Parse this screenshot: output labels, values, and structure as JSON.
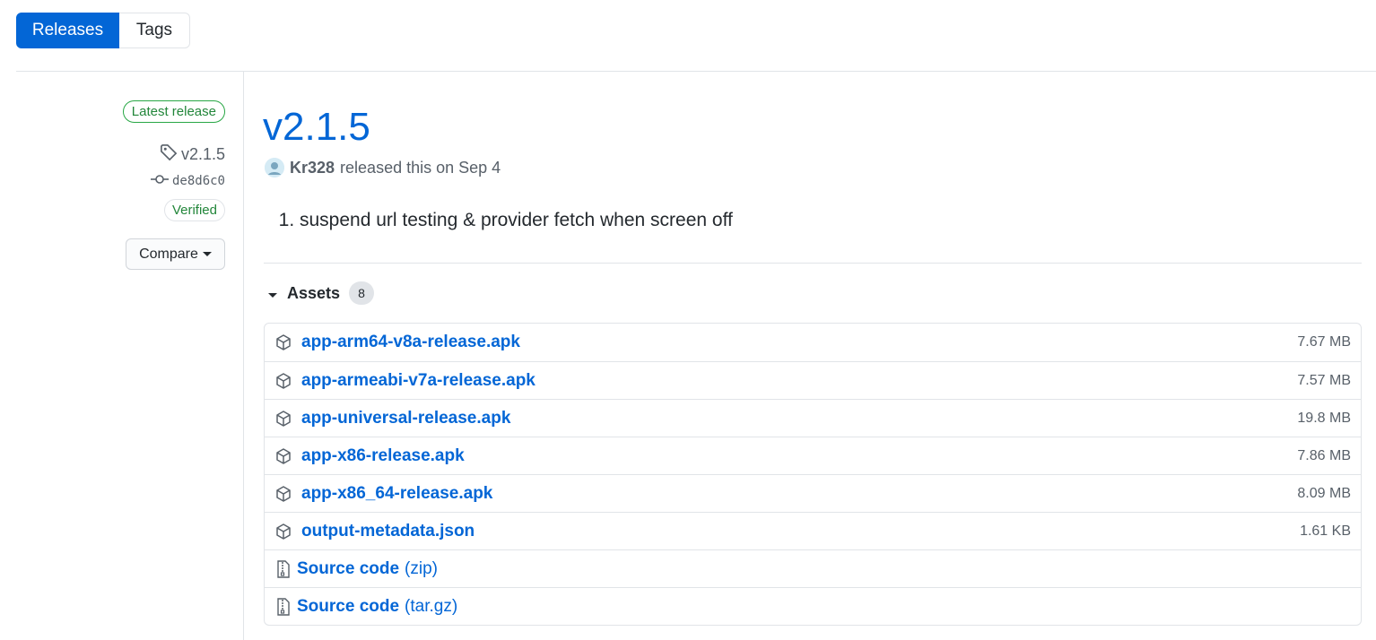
{
  "tabs": [
    {
      "label": "Releases",
      "active": true
    },
    {
      "label": "Tags",
      "active": false
    }
  ],
  "release": {
    "latest_badge": "Latest release",
    "tag": "v2.1.5",
    "commit": "de8d6c0",
    "verified_badge": "Verified",
    "compare_label": "Compare",
    "title": "v2.1.5",
    "author": "Kr328",
    "released_text": "released this on Sep 4",
    "notes": [
      "suspend url testing & provider fetch when screen off"
    ]
  },
  "assets": {
    "label": "Assets",
    "count": "8",
    "items": [
      {
        "name": "app-arm64-v8a-release.apk",
        "size": "7.67 MB",
        "icon": "package-icon"
      },
      {
        "name": "app-armeabi-v7a-release.apk",
        "size": "7.57 MB",
        "icon": "package-icon"
      },
      {
        "name": "app-universal-release.apk",
        "size": "19.8 MB",
        "icon": "package-icon"
      },
      {
        "name": "app-x86-release.apk",
        "size": "7.86 MB",
        "icon": "package-icon"
      },
      {
        "name": "app-x86_64-release.apk",
        "size": "8.09 MB",
        "icon": "package-icon"
      },
      {
        "name": "output-metadata.json",
        "size": "1.61 KB",
        "icon": "package-icon"
      },
      {
        "name": "Source code",
        "suffix": "(zip)",
        "icon": "file-zip-icon"
      },
      {
        "name": "Source code",
        "suffix": "(tar.gz)",
        "icon": "file-zip-icon"
      }
    ]
  },
  "colors": {
    "accent": "#0366d6",
    "success": "#22863a",
    "muted": "#586069",
    "border": "#e1e4e8"
  }
}
